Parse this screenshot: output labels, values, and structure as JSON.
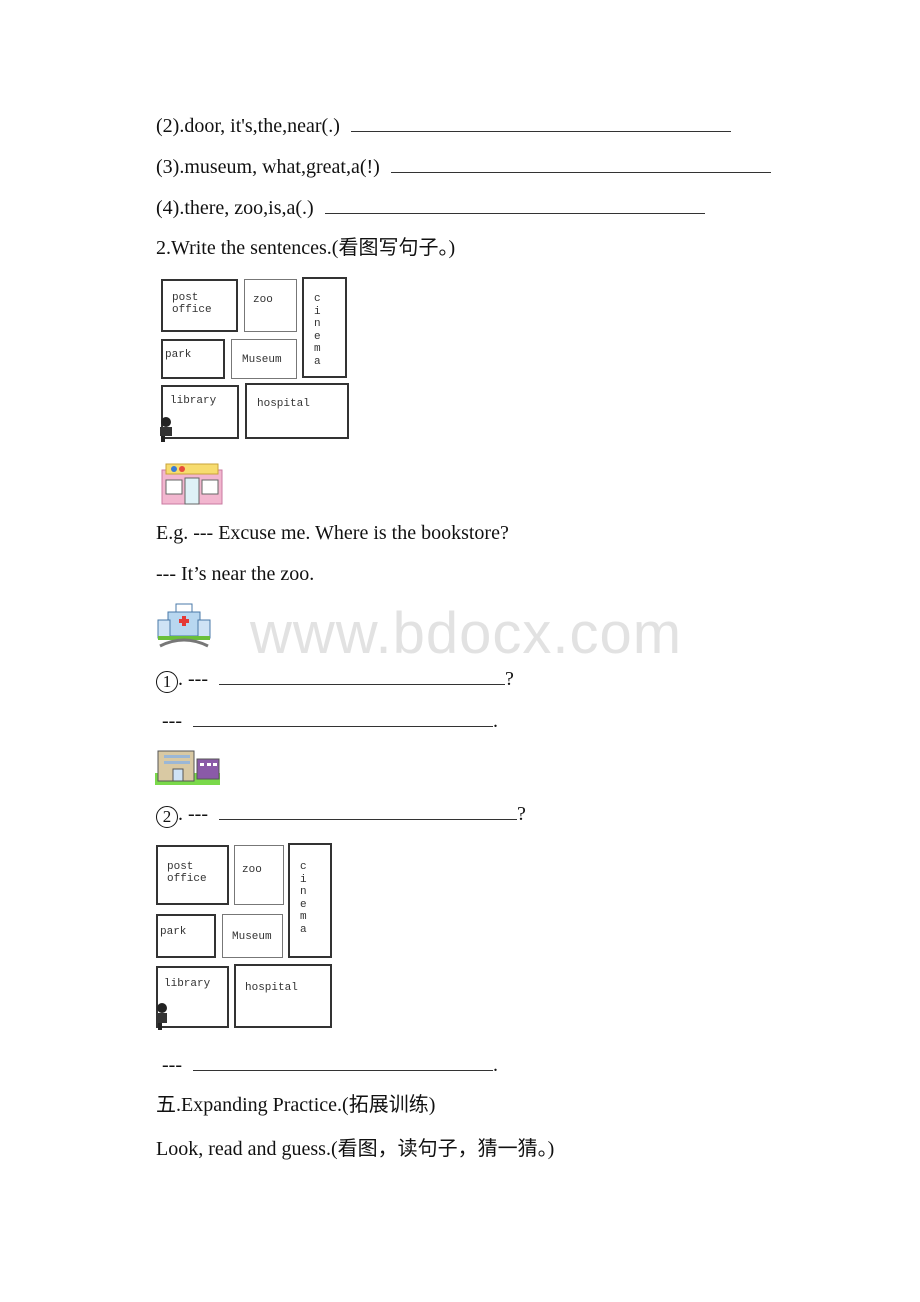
{
  "exercises_reorder": [
    {
      "prompt": "(2).door, it's,the,near(.)"
    },
    {
      "prompt": "(3).museum, what,great,a(!)"
    },
    {
      "prompt": "(4).there, zoo,is,a(.)"
    }
  ],
  "section2": {
    "heading": "2.Write the sentences.(看图写句子。)"
  },
  "map": {
    "places": [
      "post office",
      "zoo",
      "cinema",
      "park",
      "Museum",
      "library",
      "hospital"
    ]
  },
  "example": {
    "question": "E.g. --- Excuse me. Where is the bookstore?",
    "answer": " --- It’s near the zoo."
  },
  "items": [
    {
      "number": "1",
      "q_prefix": ". ---",
      "q_suffix": "?",
      "a_prefix": "---",
      "a_suffix": "."
    },
    {
      "number": "2",
      "q_prefix": ". ---",
      "q_suffix": "?",
      "a_prefix": "---",
      "a_suffix": "."
    }
  ],
  "pictures": {
    "bookstore": "bookstore-picture",
    "hospital": "hospital-picture",
    "school": "school-building-picture"
  },
  "watermark": "www.bdocx.com",
  "section5": {
    "heading": "五.Expanding Practice.(拓展训练)",
    "instruction": "Look, read and guess.(看图，读句子，猜一猜。)"
  }
}
